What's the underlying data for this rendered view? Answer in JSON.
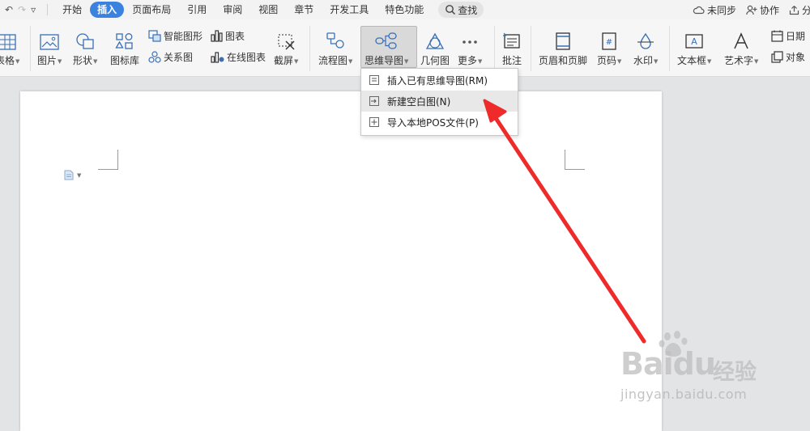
{
  "quick_access": {
    "undo": "↶",
    "redo": "↷",
    "customize": "▿"
  },
  "menu": {
    "items": [
      "开始",
      "插入",
      "页面布局",
      "引用",
      "审阅",
      "视图",
      "章节",
      "开发工具",
      "特色功能"
    ],
    "search_label": "查找"
  },
  "right_actions": {
    "sync": "未同步",
    "collab": "协作",
    "share": "分"
  },
  "ribbon": {
    "table": "表格",
    "picture": "图片",
    "shape": "形状",
    "icon_lib": "图标库",
    "smart_shape": "智能图形",
    "relation": "关系图",
    "chart": "图表",
    "online_chart": "在线图表",
    "screenshot": "截屏",
    "flowchart": "流程图",
    "mindmap": "思维导图",
    "geometry": "几何图",
    "more": "更多",
    "comment": "批注",
    "header_footer": "页眉和页脚",
    "page_num": "页码",
    "watermark": "水印",
    "textbox": "文本框",
    "wordart": "艺术字",
    "date": "日期",
    "object": "对象"
  },
  "dropdown": {
    "items": [
      "插入已有思维导图(RM)",
      "新建空白图(N)",
      "导入本地POS文件(P)"
    ],
    "highlighted_index": 1
  },
  "watermark": {
    "logo": "Baidu",
    "brand": "经验",
    "url": "jingyan.baidu.com"
  },
  "colors": {
    "accent": "#3b82e0",
    "arrow": "#ee2a2a"
  }
}
